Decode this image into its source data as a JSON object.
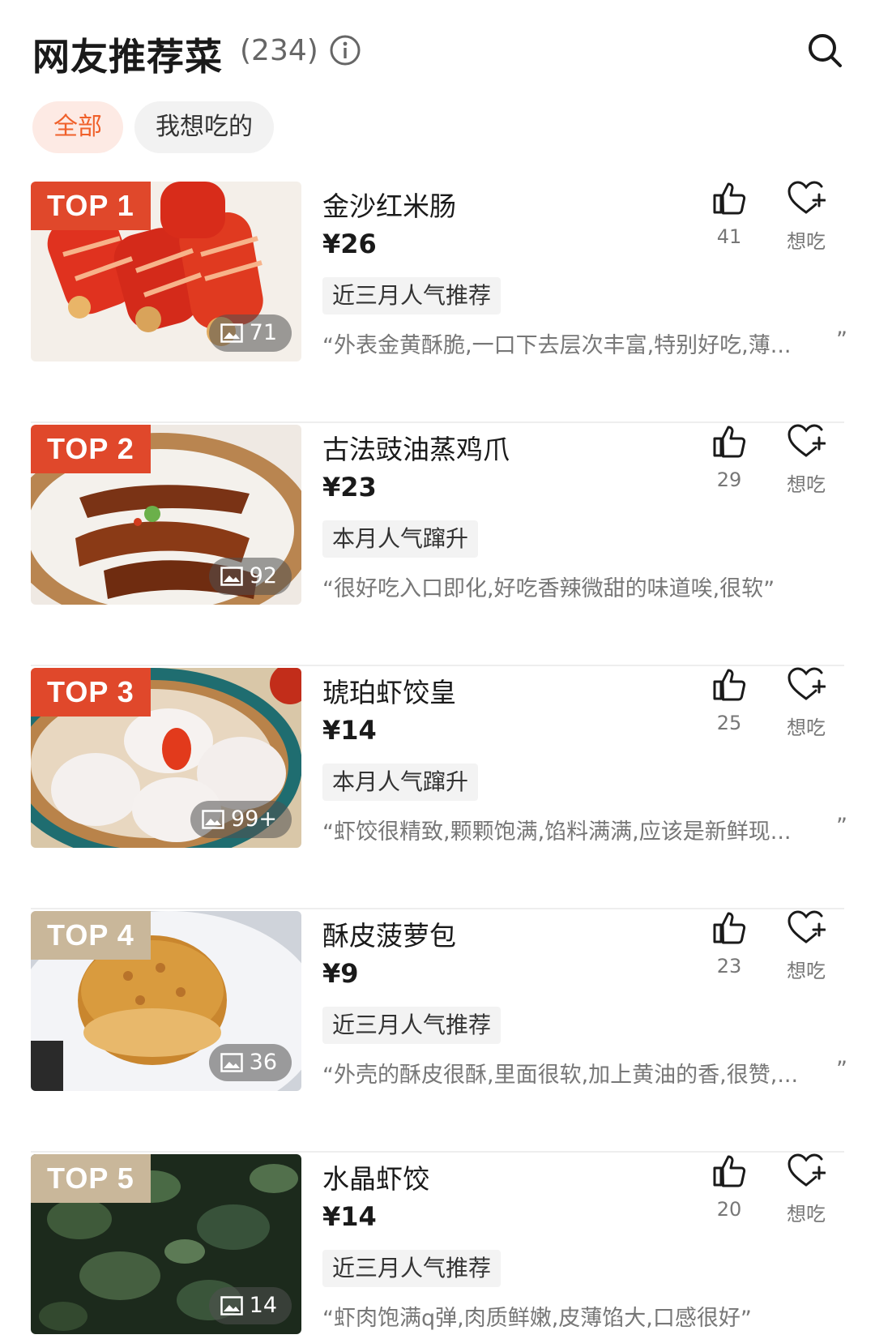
{
  "header": {
    "title": "网友推荐菜",
    "count": "(234)"
  },
  "filters": [
    {
      "label": "全部",
      "active": true
    },
    {
      "label": "我想吃的",
      "active": false
    }
  ],
  "items": [
    {
      "rank": "TOP 1",
      "name": "金沙红米肠",
      "price": "¥26",
      "tag": "近三月人气推荐",
      "quote": "外表金黄酥脆,一口下去层次丰富,特别好吃,薄...",
      "likes": "41",
      "want": "想吃",
      "photos": "71"
    },
    {
      "rank": "TOP 2",
      "name": "古法豉油蒸鸡爪",
      "price": "¥23",
      "tag": "本月人气蹿升",
      "quote": "很好吃入口即化,好吃香辣微甜的味道唉,很软",
      "likes": "29",
      "want": "想吃",
      "photos": "92"
    },
    {
      "rank": "TOP 3",
      "name": "琥珀虾饺皇",
      "price": "¥14",
      "tag": "本月人气蹿升",
      "quote": "虾饺很精致,颗颗饱满,馅料满满,应该是新鲜现...",
      "likes": "25",
      "want": "想吃",
      "photos": "99+"
    },
    {
      "rank": "TOP 4",
      "name": "酥皮菠萝包",
      "price": "¥9",
      "tag": "近三月人气推荐",
      "quote": "外壳的酥皮很酥,里面很软,加上黄油的香,很赞,...",
      "likes": "23",
      "want": "想吃",
      "photos": "36"
    },
    {
      "rank": "TOP 5",
      "name": "水晶虾饺",
      "price": "¥14",
      "tag": "近三月人气推荐",
      "quote": "虾肉饱满q弹,肉质鲜嫩,皮薄馅大,口感很好",
      "likes": "20",
      "want": "想吃",
      "photos": "14"
    }
  ],
  "colors": {
    "accent": "#f0602a",
    "rank_hot": "#e0482b",
    "rank_normal": "#c9b79a"
  }
}
